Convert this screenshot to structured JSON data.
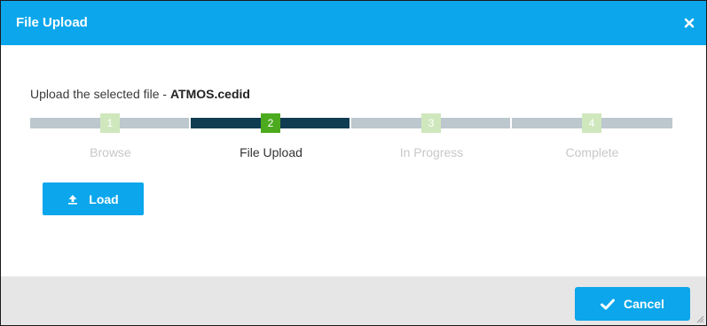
{
  "dialog": {
    "title": "File Upload",
    "close_icon": "close-icon"
  },
  "body": {
    "prefix": "Upload the selected file - ",
    "filename": "ATMOS.cedid"
  },
  "stepper": {
    "current_step": 2,
    "steps": [
      {
        "number": "1",
        "label": "Browse",
        "state": "inactive"
      },
      {
        "number": "2",
        "label": "File Upload",
        "state": "active"
      },
      {
        "number": "3",
        "label": "In Progress",
        "state": "inactive"
      },
      {
        "number": "4",
        "label": "Complete",
        "state": "inactive"
      }
    ]
  },
  "buttons": {
    "load_label": "Load",
    "load_icon": "upload-icon",
    "cancel_label": "Cancel",
    "cancel_icon": "checkmark-icon"
  },
  "colors": {
    "accent": "#0ba6eb",
    "step_active_bar": "#103c52",
    "step_inactive_bar": "#bcc7ce",
    "step_active_marker": "#4caa1e",
    "step_inactive_marker": "#cfe7bd",
    "label_active": "#333333",
    "label_inactive": "#c8c8c8",
    "footer": "#e6e6e6"
  }
}
